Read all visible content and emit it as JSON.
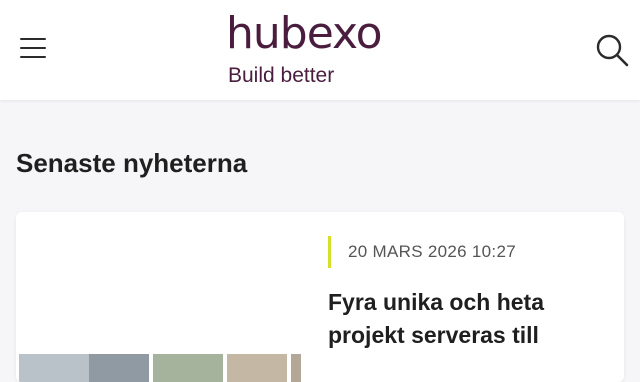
{
  "header": {
    "logo": {
      "wordmark": "hubexo",
      "tagline": "Build better"
    },
    "brand_color": "#4a1d3f",
    "menu_icon": "hamburger-menu-icon",
    "search_icon": "search-icon"
  },
  "main": {
    "heading": "Senaste nyheterna",
    "articles": [
      {
        "date": "20 MARS 2026 10:27",
        "title": "Fyra unika och heta projekt serveras till",
        "accent_color": "#d6e02a"
      }
    ]
  }
}
